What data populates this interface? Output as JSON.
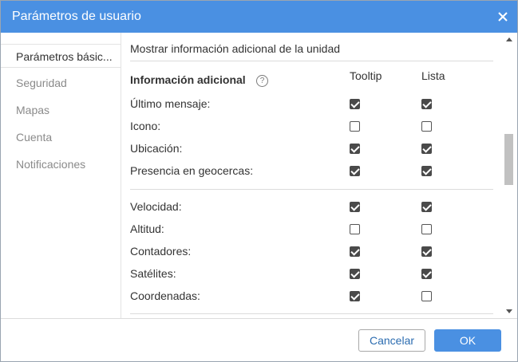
{
  "dialog": {
    "title": "Parámetros de usuario"
  },
  "sidebar": {
    "items": [
      {
        "label": "Parámetros básic..."
      },
      {
        "label": "Seguridad"
      },
      {
        "label": "Mapas"
      },
      {
        "label": "Cuenta"
      },
      {
        "label": "Notificaciones"
      }
    ]
  },
  "content": {
    "section_header": "Mostrar información adicional de la unidad",
    "group_title": "Información adicional",
    "help_icon": "?",
    "columns": {
      "tooltip": "Tooltip",
      "list": "Lista"
    },
    "rows": [
      {
        "label": "Último mensaje:",
        "tooltip": true,
        "list": true
      },
      {
        "label": "Icono:",
        "tooltip": false,
        "list": false
      },
      {
        "label": "Ubicación:",
        "tooltip": true,
        "list": true
      },
      {
        "label": "Presencia en geocercas:",
        "tooltip": true,
        "list": true
      },
      {
        "label": "Velocidad:",
        "tooltip": true,
        "list": true
      },
      {
        "label": "Altitud:",
        "tooltip": false,
        "list": false
      },
      {
        "label": "Contadores:",
        "tooltip": true,
        "list": true
      },
      {
        "label": "Satélites:",
        "tooltip": true,
        "list": true
      },
      {
        "label": "Coordenadas:",
        "tooltip": true,
        "list": false
      }
    ]
  },
  "footer": {
    "cancel_label": "Cancelar",
    "ok_label": "OK"
  }
}
